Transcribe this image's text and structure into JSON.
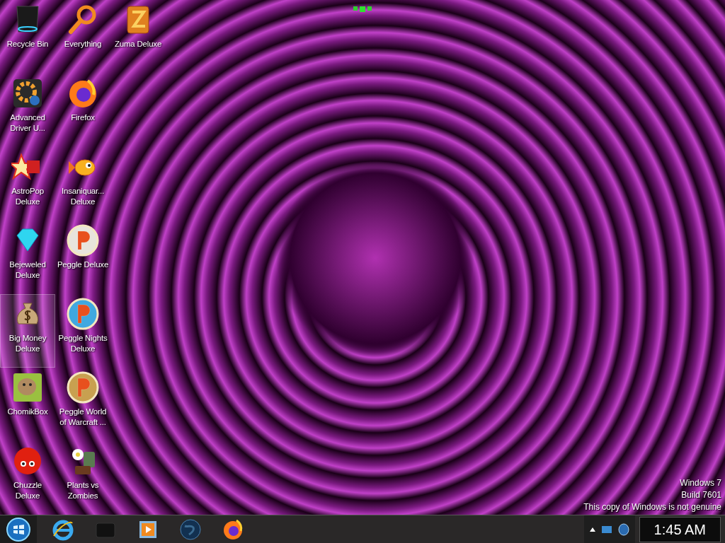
{
  "desktop_icons": [
    {
      "label": "Recycle Bin",
      "selected": false
    },
    {
      "label": "Advanced Driver U...",
      "selected": false
    },
    {
      "label": "AstroPop Deluxe",
      "selected": false
    },
    {
      "label": "Bejeweled Deluxe",
      "selected": false
    },
    {
      "label": "Big Money Deluxe",
      "selected": true
    },
    {
      "label": "ChomikBox",
      "selected": false
    },
    {
      "label": "Chuzzle Deluxe",
      "selected": false
    },
    {
      "label": "Everything",
      "selected": false
    },
    {
      "label": "Firefox",
      "selected": false
    },
    {
      "label": "Insaniquar... Deluxe",
      "selected": false
    },
    {
      "label": "Peggle Deluxe",
      "selected": false
    },
    {
      "label": "Peggle Nights Deluxe",
      "selected": false
    },
    {
      "label": "Peggle World of Warcraft ...",
      "selected": false
    },
    {
      "label": "Plants vs Zombies",
      "selected": false
    },
    {
      "label": "Zuma Deluxe",
      "selected": false
    }
  ],
  "watermark": [
    "Windows 7",
    "Build 7601",
    "This copy of Windows is not genuine"
  ],
  "taskbar": {
    "clock": "1:45 AM"
  }
}
